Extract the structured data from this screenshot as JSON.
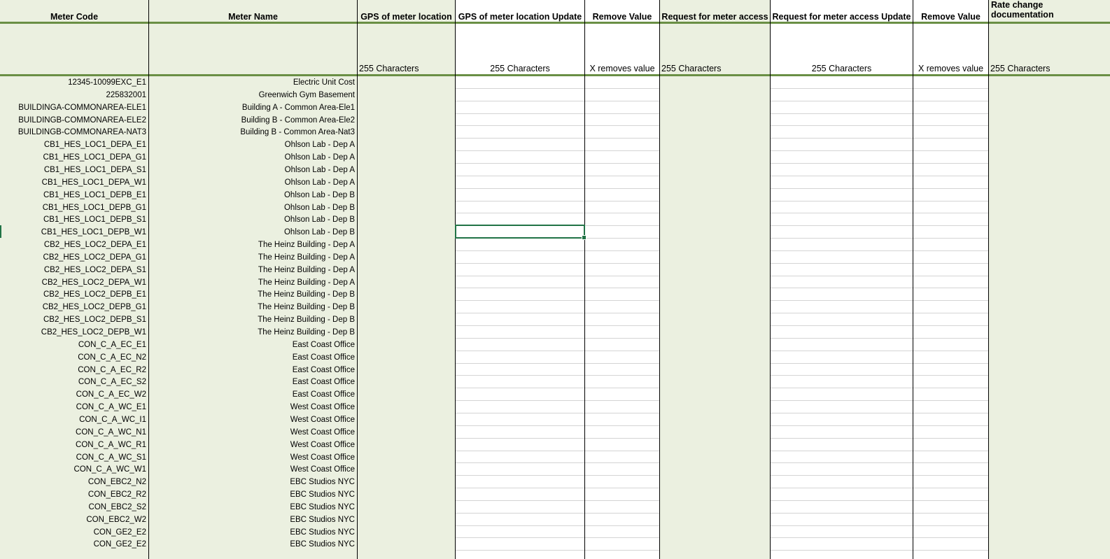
{
  "headers": {
    "meter_code": "Meter Code",
    "meter_name": "Meter Name",
    "gps": "GPS of meter location",
    "gps_update": "GPS of meter location Update",
    "remove_value_1": "Remove Value",
    "request_access": "Request for meter access",
    "request_access_update": "Request for meter access Update",
    "remove_value_2": "Remove Value",
    "rate_change": "Rate change documentation"
  },
  "subheaders": {
    "gps": "255 Characters",
    "gps_update": "255 Characters",
    "remove_value_1": "X removes value",
    "request_access": "255 Characters",
    "request_access_update": "255 Characters",
    "remove_value_2": "X removes value",
    "rate_change": "255 Characters"
  },
  "colors": {
    "green_fill": "#ebf0e0",
    "accent": "#6a8f45",
    "selection": "#217346"
  },
  "selected_cell": {
    "column": "GPS of meter location Update",
    "row_index": 12
  },
  "rows": [
    {
      "code": "12345-10099EXC_E1",
      "name": "Electric Unit Cost"
    },
    {
      "code": "225832001",
      "name": "Greenwich Gym Basement"
    },
    {
      "code": "BUILDINGA-COMMONAREA-ELE1",
      "name": "Building A - Common Area-Ele1"
    },
    {
      "code": "BUILDINGB-COMMONAREA-ELE2",
      "name": "Building B - Common Area-Ele2"
    },
    {
      "code": "BUILDINGB-COMMONAREA-NAT3",
      "name": "Building B - Common Area-Nat3"
    },
    {
      "code": "CB1_HES_LOC1_DEPA_E1",
      "name": "Ohlson Lab - Dep A"
    },
    {
      "code": "CB1_HES_LOC1_DEPA_G1",
      "name": "Ohlson Lab - Dep A"
    },
    {
      "code": "CB1_HES_LOC1_DEPA_S1",
      "name": "Ohlson Lab - Dep A"
    },
    {
      "code": "CB1_HES_LOC1_DEPA_W1",
      "name": "Ohlson Lab - Dep A"
    },
    {
      "code": "CB1_HES_LOC1_DEPB_E1",
      "name": "Ohlson Lab - Dep B"
    },
    {
      "code": "CB1_HES_LOC1_DEPB_G1",
      "name": "Ohlson Lab - Dep B"
    },
    {
      "code": "CB1_HES_LOC1_DEPB_S1",
      "name": "Ohlson Lab - Dep B"
    },
    {
      "code": "CB1_HES_LOC1_DEPB_W1",
      "name": "Ohlson Lab - Dep B"
    },
    {
      "code": "CB2_HES_LOC2_DEPA_E1",
      "name": "The Heinz Building - Dep A"
    },
    {
      "code": "CB2_HES_LOC2_DEPA_G1",
      "name": "The Heinz Building - Dep A"
    },
    {
      "code": "CB2_HES_LOC2_DEPA_S1",
      "name": "The Heinz Building - Dep A"
    },
    {
      "code": "CB2_HES_LOC2_DEPA_W1",
      "name": "The Heinz Building - Dep A"
    },
    {
      "code": "CB2_HES_LOC2_DEPB_E1",
      "name": "The Heinz Building - Dep B"
    },
    {
      "code": "CB2_HES_LOC2_DEPB_G1",
      "name": "The Heinz Building - Dep B"
    },
    {
      "code": "CB2_HES_LOC2_DEPB_S1",
      "name": "The Heinz Building - Dep B"
    },
    {
      "code": "CB2_HES_LOC2_DEPB_W1",
      "name": "The Heinz Building - Dep B"
    },
    {
      "code": "CON_C_A_EC_E1",
      "name": "East Coast Office"
    },
    {
      "code": "CON_C_A_EC_N2",
      "name": "East Coast Office"
    },
    {
      "code": "CON_C_A_EC_R2",
      "name": "East Coast Office"
    },
    {
      "code": "CON_C_A_EC_S2",
      "name": "East Coast Office"
    },
    {
      "code": "CON_C_A_EC_W2",
      "name": "East Coast Office"
    },
    {
      "code": "CON_C_A_WC_E1",
      "name": "West Coast Office"
    },
    {
      "code": "CON_C_A_WC_I1",
      "name": "West Coast Office"
    },
    {
      "code": "CON_C_A_WC_N1",
      "name": "West Coast Office"
    },
    {
      "code": "CON_C_A_WC_R1",
      "name": "West Coast Office"
    },
    {
      "code": "CON_C_A_WC_S1",
      "name": "West Coast Office"
    },
    {
      "code": "CON_C_A_WC_W1",
      "name": "West Coast Office"
    },
    {
      "code": "CON_EBC2_N2",
      "name": "EBC Studios NYC"
    },
    {
      "code": "CON_EBC2_R2",
      "name": "EBC Studios NYC"
    },
    {
      "code": "CON_EBC2_S2",
      "name": "EBC Studios NYC"
    },
    {
      "code": "CON_EBC2_W2",
      "name": "EBC Studios NYC"
    },
    {
      "code": "CON_GE2_E2",
      "name": "EBC Studios NYC"
    },
    {
      "code": "CON_GE2_E2",
      "name": "EBC Studios NYC"
    }
  ]
}
